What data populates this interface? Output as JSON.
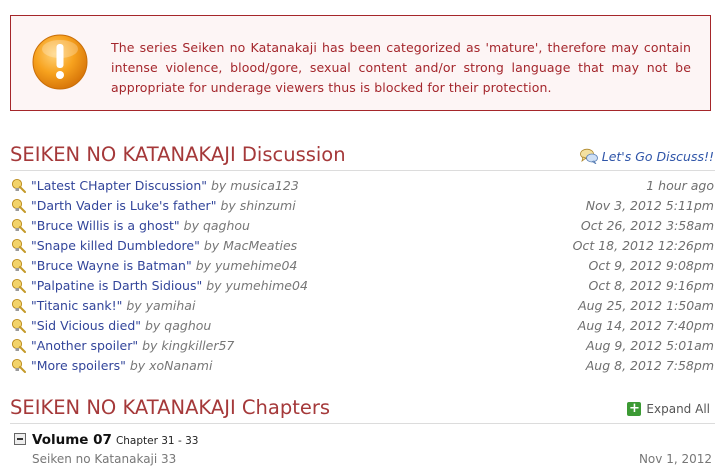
{
  "warning": {
    "text": "The series Seiken no Katanakaji has been categorized as 'mature', therefore may contain intense violence, blood/gore, sexual content and/or strong language that may not be appropriate for underage viewers thus is blocked for their protection.",
    "icon": "exclamation-icon",
    "color": "#a4262c"
  },
  "discussion": {
    "title": "SEIKEN NO KATANAKAJI Discussion",
    "link_label": "Let's Go Discuss!!",
    "items": [
      {
        "title": "\"Latest CHapter Discussion\"",
        "by": "by musica123",
        "date": "1 hour ago"
      },
      {
        "title": "\"Darth Vader is Luke's father\"",
        "by": "by shinzumi",
        "date": "Nov 3, 2012 5:11pm"
      },
      {
        "title": "\"Bruce Willis is a ghost\"",
        "by": "by qaghou",
        "date": "Oct 26, 2012 3:58am"
      },
      {
        "title": "\"Snape killed Dumbledore\"",
        "by": "by MacMeaties",
        "date": "Oct 18, 2012 12:26pm"
      },
      {
        "title": "\"Bruce Wayne is Batman\"",
        "by": "by yumehime04",
        "date": "Oct 9, 2012 9:08pm"
      },
      {
        "title": "\"Palpatine is Darth Sidious\"",
        "by": "by yumehime04",
        "date": "Oct 8, 2012 9:16pm"
      },
      {
        "title": "\"Titanic sank!\"",
        "by": "by yamihai",
        "date": "Aug 25, 2012 1:50am"
      },
      {
        "title": "\"Sid Vicious died\"",
        "by": "by qaghou",
        "date": "Aug 14, 2012 7:40pm"
      },
      {
        "title": "\"Another spoiler\"",
        "by": "by kingkiller57",
        "date": "Aug 9, 2012 5:01am"
      },
      {
        "title": "\"More spoilers\"",
        "by": "by xoNanami",
        "date": "Aug 8, 2012 7:58pm"
      }
    ]
  },
  "chapters": {
    "title": "SEIKEN NO KATANAKAJI Chapters",
    "expand_label": "Expand All",
    "volume": {
      "name": "Volume 07",
      "range": "Chapter 31 - 33"
    },
    "partial_row": {
      "title": "Seiken no Katanakaji 33",
      "date": "Nov 1, 2012"
    }
  },
  "colors": {
    "section_title": "#a5393a",
    "link": "#32459a",
    "warning_border": "#a5262a",
    "warning_bg": "#fdf5f5"
  }
}
